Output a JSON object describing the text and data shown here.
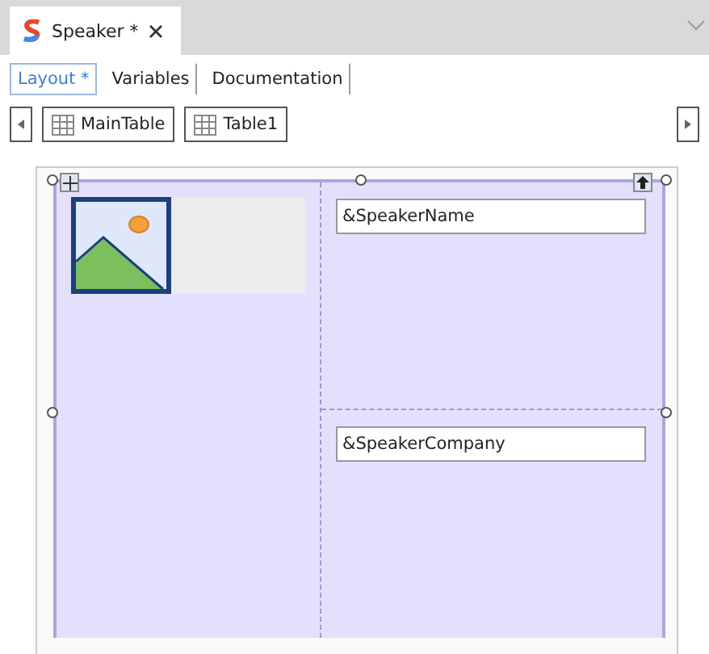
{
  "document_tab": {
    "title": "Speaker *",
    "selected": true
  },
  "subtabs": [
    {
      "label": "Layout *",
      "selected": true
    },
    {
      "label": "Variables",
      "selected": false
    },
    {
      "label": "Documentation",
      "selected": false
    }
  ],
  "breadcrumbs": [
    {
      "label": "MainTable"
    },
    {
      "label": "Table1"
    }
  ],
  "layout_table": {
    "fields": [
      {
        "value": "&SpeakerName"
      },
      {
        "value": "&SpeakerCompany"
      }
    ]
  }
}
